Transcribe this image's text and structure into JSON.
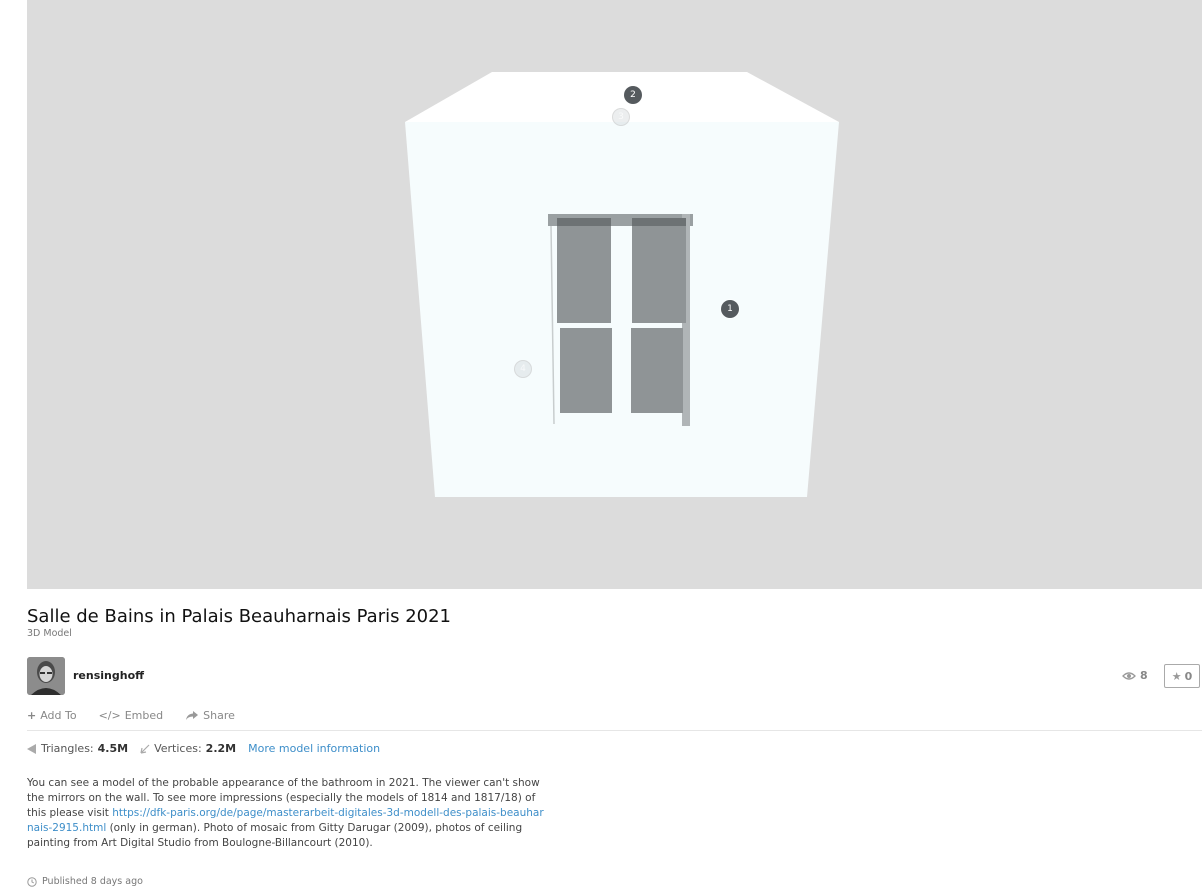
{
  "viewer": {
    "hotspots": [
      {
        "label": "2",
        "style": "dark"
      },
      {
        "label": "3",
        "style": "ghost"
      },
      {
        "label": "1",
        "style": "dark"
      },
      {
        "label": "4",
        "style": "ghost"
      }
    ]
  },
  "model": {
    "title": "Salle de Bains in Palais Beauharnais Paris 2021",
    "type": "3D Model",
    "author": "rensinghoff",
    "views": "8",
    "likes": "0",
    "published": "Published 8 days ago"
  },
  "actions": {
    "add_to": "Add To",
    "embed": "Embed",
    "share": "Share"
  },
  "stats": {
    "triangles_label": "Triangles:",
    "triangles_value": "4.5M",
    "vertices_label": "Vertices:",
    "vertices_value": "2.2M",
    "more_info": "More model information"
  },
  "description": {
    "text_before": "You can see a model of the probable appearance of the bathroom in 2021. The viewer can't show the mirrors on the wall. To see more impressions (especially the models of 1814 and 1817/18) of this please visit ",
    "link": "https://dfk-paris.org/de/page/masterarbeit-digitales-3d-modell-des-palais-beauharnais-2915.html",
    "text_after": " (only in german). Photo of mosaic from Gitty Darugar (2009), photos of ceiling painting from Art Digital Studio from Boulogne-Billancourt (2010)."
  },
  "colors": {
    "viewer_bg": "#dcdcdc",
    "link": "#3d8ec9",
    "wall": "#f6fcfd"
  }
}
